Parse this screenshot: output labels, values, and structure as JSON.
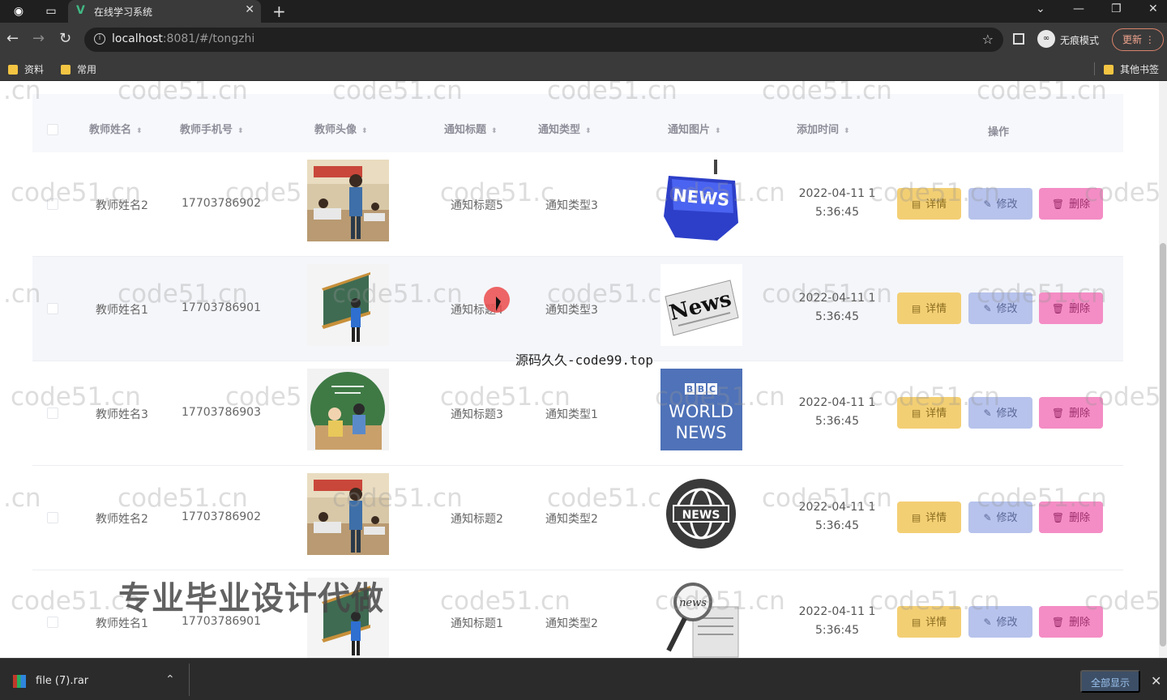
{
  "browser": {
    "tab_title": "在线学习系统",
    "url_host": "localhost",
    "url_rest": ":8081/#/tongzhi",
    "incognito_label": "无痕模式",
    "update_label": "更新",
    "bookmarks": [
      "资料",
      "常用"
    ],
    "other_bookmarks": "其他书签"
  },
  "table": {
    "headers": [
      "教师姓名",
      "教师手机号",
      "教师头像",
      "通知标题",
      "通知类型",
      "通知图片",
      "添加时间",
      "操作"
    ],
    "rows": [
      {
        "name": "教师姓名2",
        "phone": "17703786902",
        "title": "通知标题5",
        "type": "通知类型3",
        "time_line1": "2022-04-11 1",
        "time_line2": "5:36:45",
        "avatar_icon": "teacher-classroom-photo",
        "news_icon": "news-keyboard-key"
      },
      {
        "name": "教师姓名1",
        "phone": "17703786901",
        "title": "通知标题4",
        "type": "通知类型3",
        "time_line1": "2022-04-11 1",
        "time_line2": "5:36:45",
        "avatar_icon": "teacher-blackboard-illustration",
        "news_icon": "news-newspaper"
      },
      {
        "name": "教师姓名3",
        "phone": "17703786903",
        "title": "通知标题3",
        "type": "通知类型1",
        "time_line1": "2022-04-11 1",
        "time_line2": "5:36:45",
        "avatar_icon": "teacher-round-illustration",
        "news_icon": "bbc-world-news"
      },
      {
        "name": "教师姓名2",
        "phone": "17703786902",
        "title": "通知标题2",
        "type": "通知类型2",
        "time_line1": "2022-04-11 1",
        "time_line2": "5:36:45",
        "avatar_icon": "teacher-classroom-photo",
        "news_icon": "news-globe"
      },
      {
        "name": "教师姓名1",
        "phone": "17703786901",
        "title": "通知标题1",
        "type": "通知类型2",
        "time_line1": "2022-04-11 1",
        "time_line2": "5:36:45",
        "avatar_icon": "teacher-blackboard-illustration",
        "news_icon": "news-magnifier"
      }
    ],
    "actions": {
      "detail": "详情",
      "edit": "修改",
      "delete": "删除"
    }
  },
  "overlay": {
    "center_text": "源码久久-code99.top",
    "big_watermark": "专业毕业设计代做",
    "tile_watermark": "code51.cn",
    "tile_watermark_short": ".cn",
    "tile_watermark_partial1": "code5",
    "tile_watermark_partial2": "code51.c",
    "tile_watermark_partial3": "code51.cn"
  },
  "downloads": {
    "file_name": "file (7).rar",
    "show_all": "全部显示"
  },
  "colors": {
    "detail_button": "#f3cf74",
    "edit_button": "#b7c3ec",
    "delete_button": "#f48dc5"
  }
}
